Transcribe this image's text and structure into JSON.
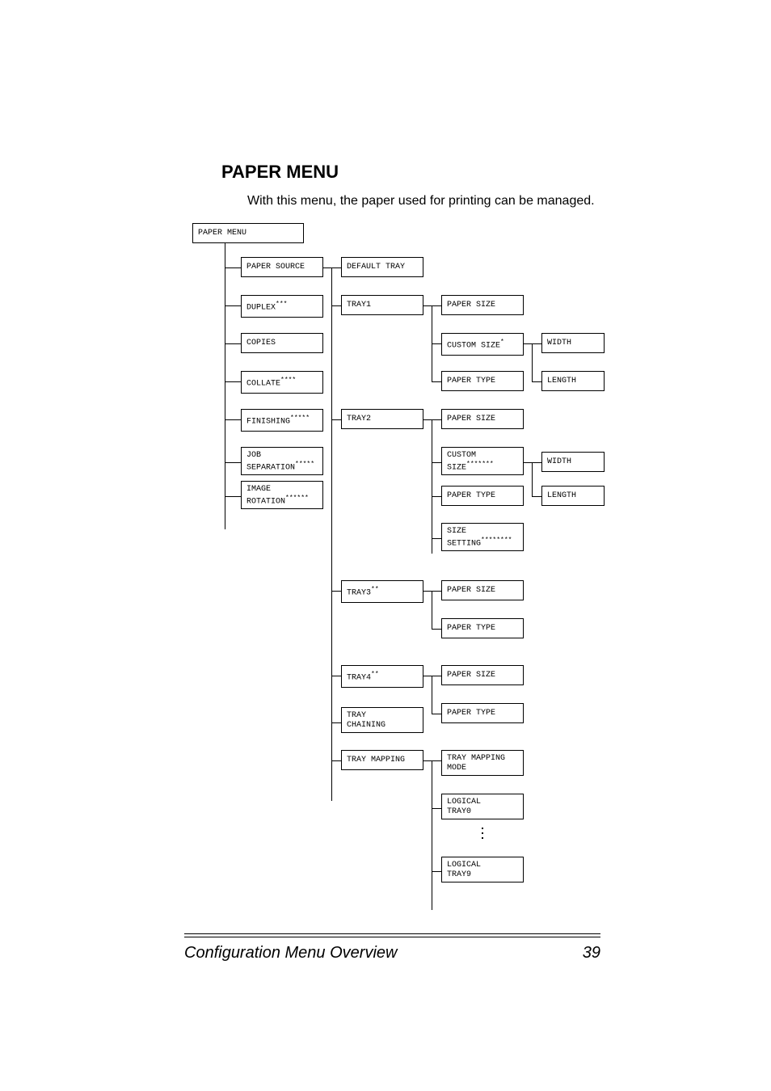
{
  "heading": "PAPER MENU",
  "intro": "With this menu, the paper used for printing can be managed.",
  "root": "PAPER MENU",
  "col1": {
    "paper_source": "PAPER SOURCE",
    "duplex": "DUPLEX",
    "duplex_sup": "***",
    "copies": "COPIES",
    "collate": "COLLATE",
    "collate_sup": "****",
    "finishing": "FINISHING",
    "finishing_sup": "*****",
    "job_sep": "JOB\nSEPARATION",
    "job_sep_sup": "*****",
    "image_rot": "IMAGE\nROTATION",
    "image_rot_sup": "******"
  },
  "col2": {
    "default_tray": "DEFAULT TRAY",
    "tray1": "TRAY1",
    "tray2": "TRAY2",
    "tray3": "TRAY3",
    "tray3_sup": "**",
    "tray4": "TRAY4",
    "tray4_sup": "**",
    "tray_chaining": "TRAY\nCHAINING",
    "tray_mapping": "TRAY MAPPING"
  },
  "col3": {
    "paper_size": "PAPER SIZE",
    "custom_size": "CUSTOM SIZE",
    "custom_size_sup": "*",
    "paper_type": "PAPER TYPE",
    "custom_size2": "CUSTOM\nSIZE",
    "custom_size2_sup": "*******",
    "size_setting": "SIZE\nSETTING",
    "size_setting_sup": "********",
    "tray_mapping_mode": "TRAY MAPPING\nMODE",
    "logical0": "LOGICAL\nTRAY0",
    "logical9": "LOGICAL\nTRAY9"
  },
  "col4": {
    "width": "WIDTH",
    "length": "LENGTH"
  },
  "footer": {
    "title": "Configuration Menu Overview",
    "page": "39"
  }
}
